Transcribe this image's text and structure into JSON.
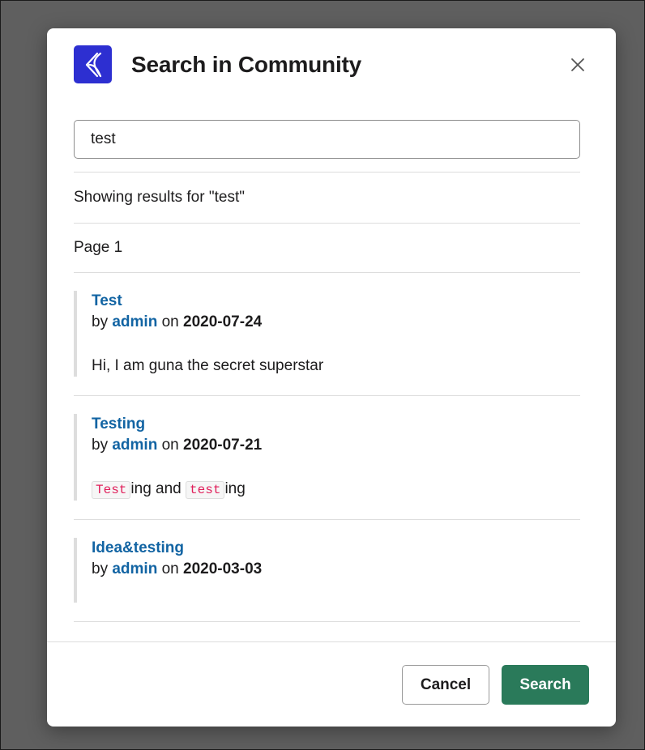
{
  "modal": {
    "title": "Search in Community",
    "close_icon": "close-icon",
    "logo_icon": "community-app-logo",
    "accent_color": "#2d2fd1"
  },
  "search": {
    "value": "test",
    "placeholder": ""
  },
  "summary": {
    "text": "Showing results for \"test\""
  },
  "pagination": {
    "label": "Page 1"
  },
  "results": [
    {
      "title": "Test",
      "by": "by",
      "author": "admin",
      "on": "on",
      "date": "2020-07-24",
      "snippet": "Hi, I am guna the secret superstar"
    },
    {
      "title": "Testing",
      "by": "by",
      "author": "admin",
      "on": "on",
      "date": "2020-07-21",
      "snippet_parts": {
        "hl1": "Test",
        "t1": "ing and ",
        "hl2": "test",
        "t2": "ing"
      }
    },
    {
      "title": "Idea&testing",
      "by": "by",
      "author": "admin",
      "on": "on",
      "date": "2020-03-03"
    }
  ],
  "footer": {
    "cancel_label": "Cancel",
    "search_label": "Search",
    "primary_color": "#2a7a5a",
    "link_color": "#1264a3"
  }
}
